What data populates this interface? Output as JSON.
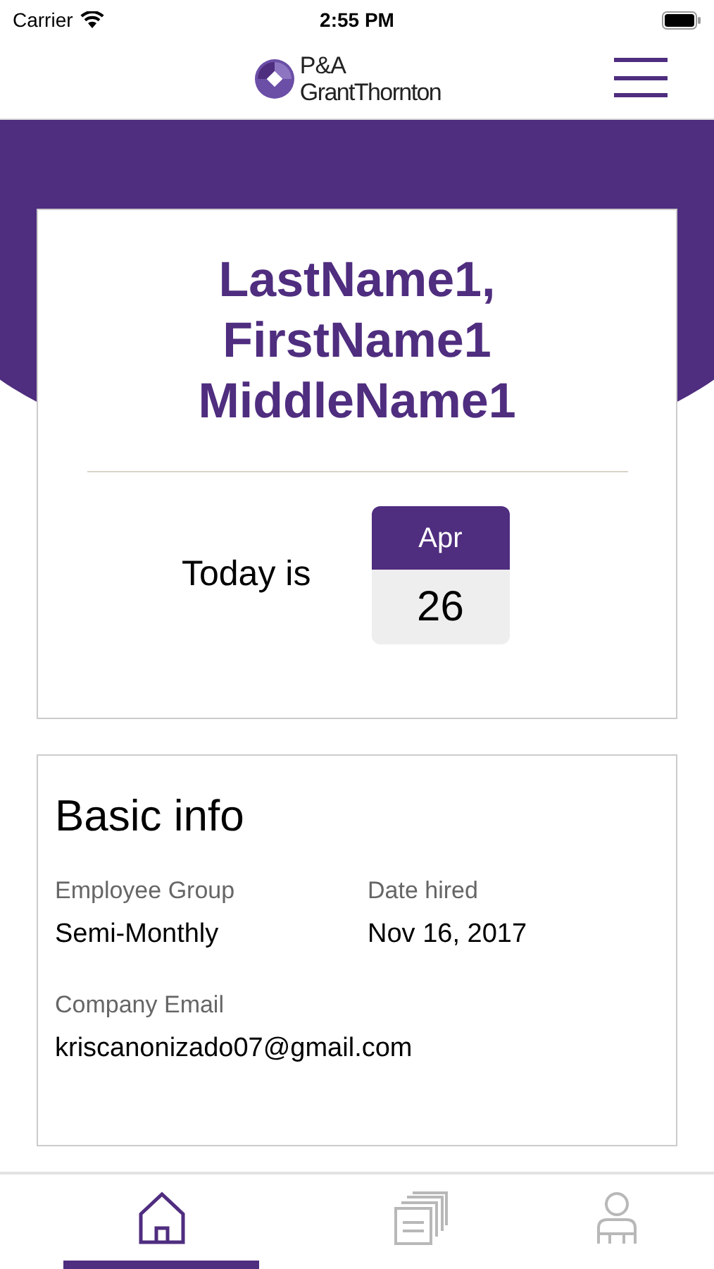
{
  "status_bar": {
    "carrier": "Carrier",
    "time": "2:55 PM"
  },
  "header": {
    "logo_line_1": "P&A",
    "logo_line_2": "GrantThornton"
  },
  "profile_card": {
    "name": "LastName1, FirstName1 MiddleName1",
    "today_label": "Today is",
    "month": "Apr",
    "day": "26"
  },
  "basic_info": {
    "title": "Basic info",
    "fields": [
      {
        "label": "Employee Group",
        "value": "Semi-Monthly"
      },
      {
        "label": "Date hired",
        "value": "Nov 16, 2017"
      },
      {
        "label": "Company Email",
        "value": "kriscanonizado07@gmail.com"
      }
    ]
  },
  "tab_bar": [
    {
      "kind": "home",
      "selected": true
    },
    {
      "kind": "documents",
      "selected": false
    },
    {
      "kind": "profile",
      "selected": false
    }
  ]
}
